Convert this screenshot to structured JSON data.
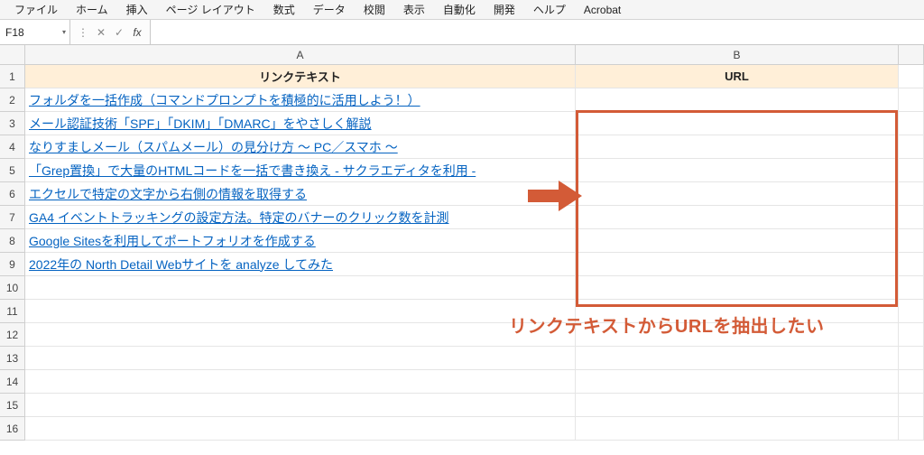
{
  "menubar": {
    "items": [
      "ファイル",
      "ホーム",
      "挿入",
      "ページ レイアウト",
      "数式",
      "データ",
      "校閲",
      "表示",
      "自動化",
      "開発",
      "ヘルプ",
      "Acrobat"
    ]
  },
  "namebox": {
    "value": "F18"
  },
  "formula": {
    "value": ""
  },
  "columns": {
    "A": "A",
    "B": "B"
  },
  "row_labels": [
    "1",
    "2",
    "3",
    "4",
    "5",
    "6",
    "7",
    "8",
    "9",
    "10",
    "11",
    "12",
    "13",
    "14",
    "15",
    "16"
  ],
  "headers": {
    "col_a": "リンクテキスト",
    "col_b": "URL"
  },
  "links": [
    "フォルダを一括作成（コマンドプロンプトを積極的に活用しよう！）",
    "メール認証技術「SPF」「DKIM」「DMARC」をやさしく解説",
    "なりすましメール（スパムメール）の見分け方 〜 PC／スマホ 〜",
    "「Grep置換」で大量のHTMLコードを一括で書き換え - サクラエディタを利用 -",
    "エクセルで特定の文字から右側の情報を取得する",
    "GA4 イベントトラッキングの設定方法。特定のバナーのクリック数を計測",
    "Google Sitesを利用してポートフォリオを作成する",
    "2022年の North Detail Webサイトを analyze してみた"
  ],
  "annotation": {
    "caption": "リンクテキストからURLを抽出したい"
  },
  "colors": {
    "accent": "#d35b37",
    "link": "#0563c1",
    "header_fill": "#ffefd8"
  }
}
